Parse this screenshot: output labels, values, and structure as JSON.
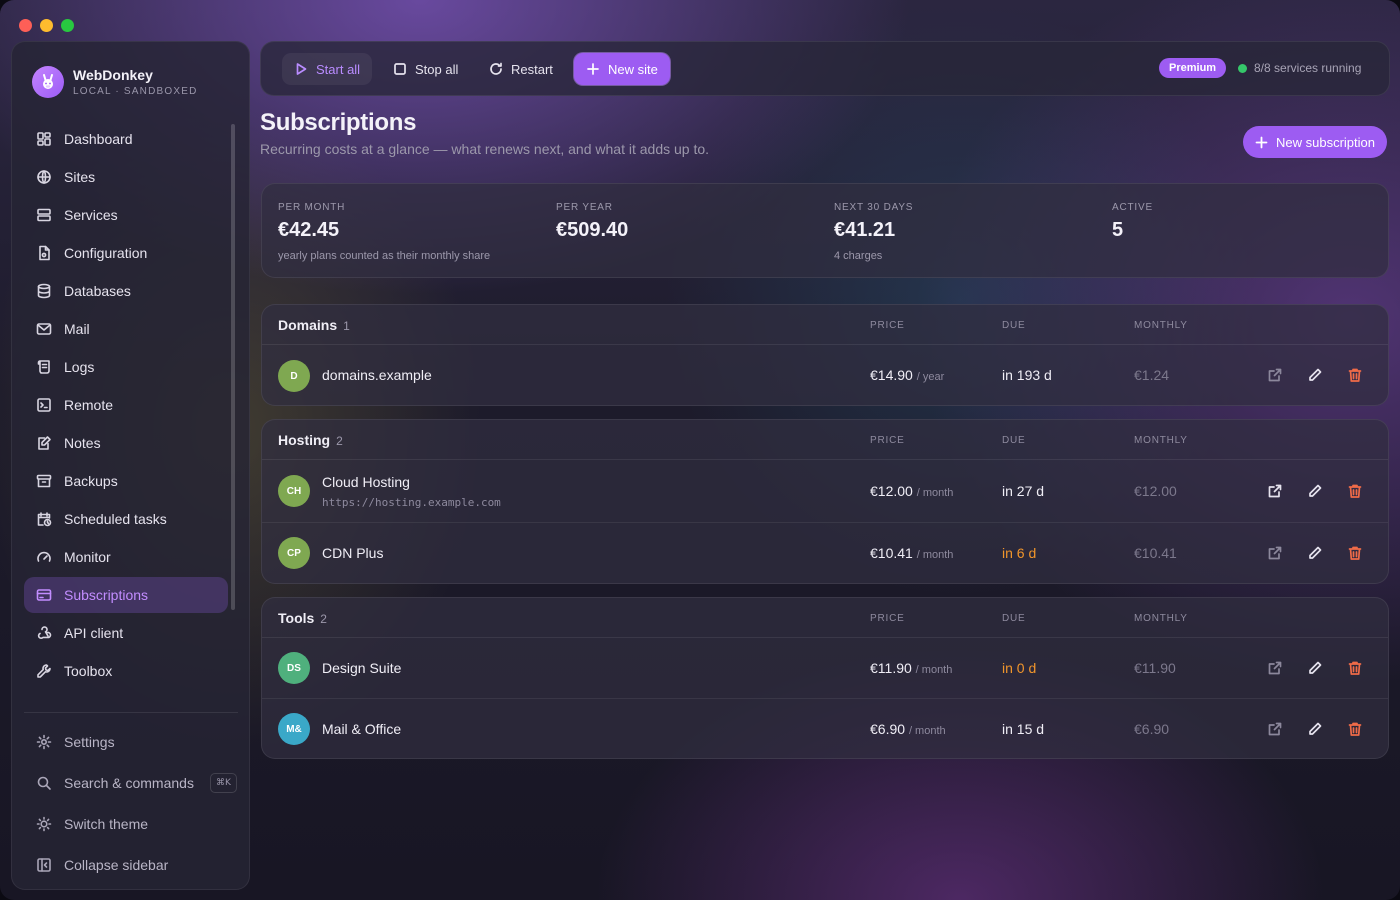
{
  "brand": {
    "name": "WebDonkey",
    "subtitle": "LOCAL · SANDBOXED"
  },
  "sidebar": {
    "items": [
      {
        "label": "Dashboard",
        "icon": "dashboard-icon"
      },
      {
        "label": "Sites",
        "icon": "globe-icon"
      },
      {
        "label": "Services",
        "icon": "server-icon"
      },
      {
        "label": "Configuration",
        "icon": "config-file-icon"
      },
      {
        "label": "Databases",
        "icon": "database-icon"
      },
      {
        "label": "Mail",
        "icon": "mail-icon"
      },
      {
        "label": "Logs",
        "icon": "scroll-icon"
      },
      {
        "label": "Remote",
        "icon": "terminal-icon"
      },
      {
        "label": "Notes",
        "icon": "notes-icon"
      },
      {
        "label": "Backups",
        "icon": "archive-icon"
      },
      {
        "label": "Scheduled tasks",
        "icon": "calendar-clock-icon"
      },
      {
        "label": "Monitor",
        "icon": "gauge-icon"
      },
      {
        "label": "Subscriptions",
        "icon": "credit-card-icon",
        "active": true
      },
      {
        "label": "API client",
        "icon": "webhook-icon"
      },
      {
        "label": "Toolbox",
        "icon": "wrench-icon"
      }
    ],
    "bottom": {
      "settings": "Settings",
      "search": "Search & commands",
      "search_shortcut": "⌘K",
      "theme": "Switch theme",
      "collapse": "Collapse sidebar"
    }
  },
  "toolbar": {
    "start_all": "Start all",
    "stop_all": "Stop all",
    "restart": "Restart",
    "new_site": "New site",
    "premium_badge": "Premium",
    "status_text": "8/8 services running",
    "status_color": "#35c76a"
  },
  "page": {
    "title": "Subscriptions",
    "subtitle": "Recurring costs at a glance — what renews next, and what it adds up to.",
    "new_button": "New subscription"
  },
  "stats": {
    "per_month": {
      "label": "PER MONTH",
      "value": "€42.45",
      "note": "yearly plans counted as their monthly share"
    },
    "per_year": {
      "label": "PER YEAR",
      "value": "€509.40"
    },
    "next_30": {
      "label": "NEXT 30 DAYS",
      "value": "€41.21",
      "note": "4 charges"
    },
    "active": {
      "label": "ACTIVE",
      "value": "5"
    }
  },
  "columns": {
    "price": "PRICE",
    "due": "DUE",
    "monthly": "MONTHLY"
  },
  "groups": [
    {
      "name": "Domains",
      "count": "1",
      "rows": [
        {
          "initials": "D",
          "name": "domains.example",
          "price": "€14.90",
          "period": "/ year",
          "due": "in 193 d",
          "monthly": "€1.24"
        }
      ]
    },
    {
      "name": "Hosting",
      "count": "2",
      "rows": [
        {
          "initials": "CH",
          "name": "Cloud Hosting",
          "url": "https://hosting.example.com",
          "price": "€12.00",
          "period": "/ month",
          "due": "in 27 d",
          "monthly": "€12.00"
        },
        {
          "initials": "CP",
          "name": "CDN Plus",
          "price": "€10.41",
          "period": "/ month",
          "due": "in 6 d",
          "monthly": "€10.41",
          "due_soon": true
        }
      ]
    },
    {
      "name": "Tools",
      "count": "2",
      "rows": [
        {
          "initials": "DS",
          "name": "Design Suite",
          "price": "€11.90",
          "period": "/ month",
          "due": "in 0 d",
          "monthly": "€11.90",
          "due_soon": true
        },
        {
          "initials": "M&",
          "name": "Mail & Office",
          "price": "€6.90",
          "period": "/ month",
          "due": "in 15 d",
          "monthly": "€6.90"
        }
      ]
    }
  ],
  "colors": {
    "accent": "#9d5cf2",
    "due_soon": "#f0952b",
    "delete": "#ef6b48"
  }
}
